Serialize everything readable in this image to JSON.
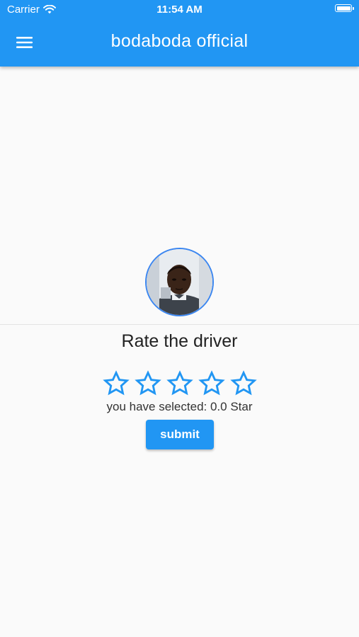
{
  "status_bar": {
    "carrier": "Carrier",
    "time": "11:54 AM"
  },
  "app_bar": {
    "title": "bodaboda official",
    "menu_icon": "menu-icon",
    "color": "#2196f3"
  },
  "rating": {
    "title": "Rate the driver",
    "star_icon": "star-outline-icon",
    "star_count": 5,
    "selected_value": 0.0,
    "selected_text": "you have selected: 0.0 Star",
    "star_color": "#2196f3"
  },
  "actions": {
    "submit_label": "submit"
  }
}
